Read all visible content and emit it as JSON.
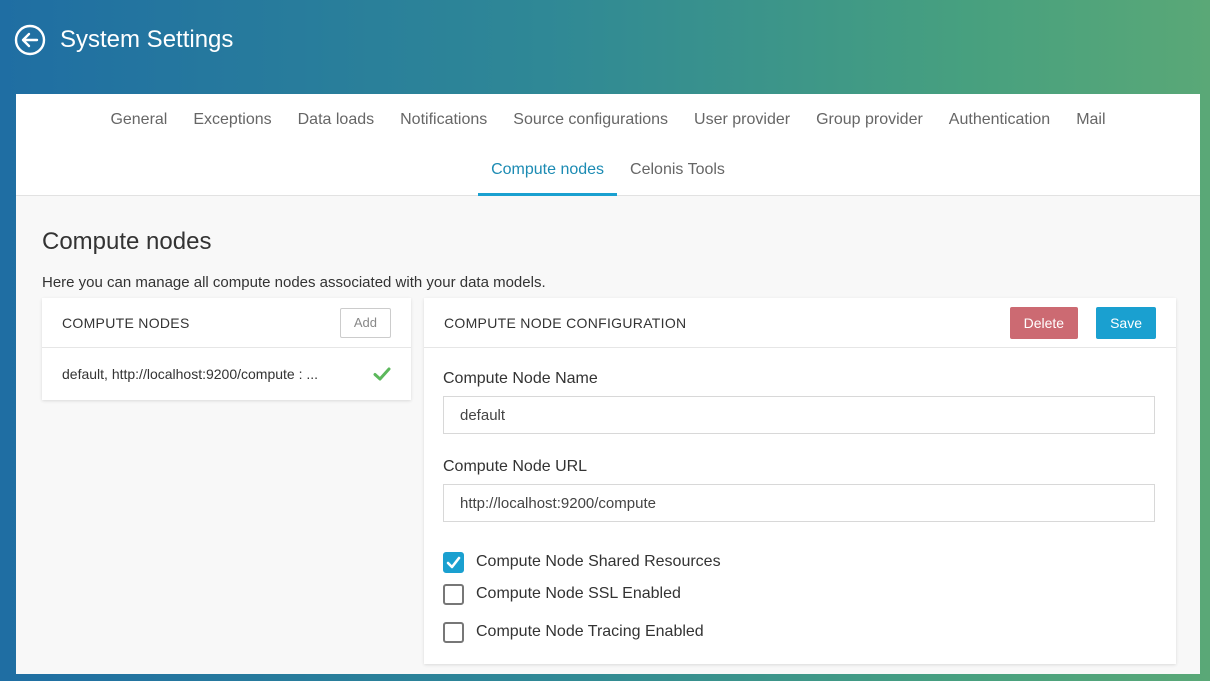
{
  "header": {
    "title": "System Settings"
  },
  "tabs": {
    "row1": [
      "General",
      "Exceptions",
      "Data loads",
      "Notifications",
      "Source configurations",
      "User provider",
      "Group provider",
      "Authentication",
      "Mail"
    ],
    "row2": [
      "Compute nodes",
      "Celonis Tools"
    ],
    "active": "Compute nodes"
  },
  "page": {
    "title": "Compute nodes",
    "description": "Here you can manage all compute nodes associated with your data models."
  },
  "nodes_card": {
    "title": "COMPUTE NODES",
    "add_label": "Add",
    "items": [
      {
        "label": "default, http://localhost:9200/compute : ...",
        "status": "ok"
      }
    ]
  },
  "config_card": {
    "title": "COMPUTE NODE CONFIGURATION",
    "delete_label": "Delete",
    "save_label": "Save",
    "name_label": "Compute Node Name",
    "name_value": "default",
    "url_label": "Compute Node URL",
    "url_value": "http://localhost:9200/compute",
    "options": [
      {
        "label": "Compute Node Shared Resources",
        "checked": true
      },
      {
        "label": "Compute Node SSL Enabled",
        "checked": false
      },
      {
        "label": "Compute Node Tracing Enabled",
        "checked": false
      }
    ]
  },
  "colors": {
    "accent": "#1aa0d0",
    "delete": "#cc6a72",
    "success": "#5cb85c",
    "header_gradient_start": "#1f6ea3",
    "header_gradient_end": "#5aa877"
  },
  "icons": {
    "back": "arrow-left-circle-icon",
    "status": "checkmark-icon",
    "checkbox": "check-icon"
  }
}
